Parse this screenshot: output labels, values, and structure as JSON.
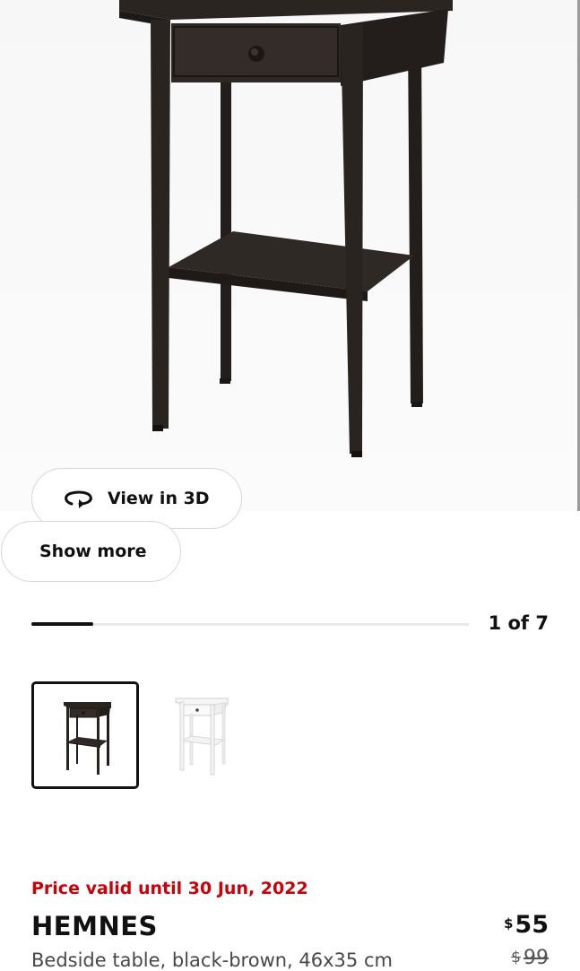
{
  "gallery": {
    "view_3d_label": "View in 3D",
    "show_more_label": "Show more",
    "counter": "1 of 7",
    "progress_fraction": 0.142
  },
  "thumbnails": [
    {
      "variant": "black-brown",
      "selected": true
    },
    {
      "variant": "white",
      "selected": false
    }
  ],
  "product": {
    "price_validity": "Price valid until 30 Jun, 2022",
    "name": "HEMNES",
    "description": "Bedside table, black-brown, 46x35 cm",
    "currency_symbol": "$",
    "price": "55",
    "previous_price": "99"
  },
  "colors": {
    "price_notice": "#cc0008",
    "table_dark": "#2b2522",
    "table_white": "#f2f2f2"
  }
}
